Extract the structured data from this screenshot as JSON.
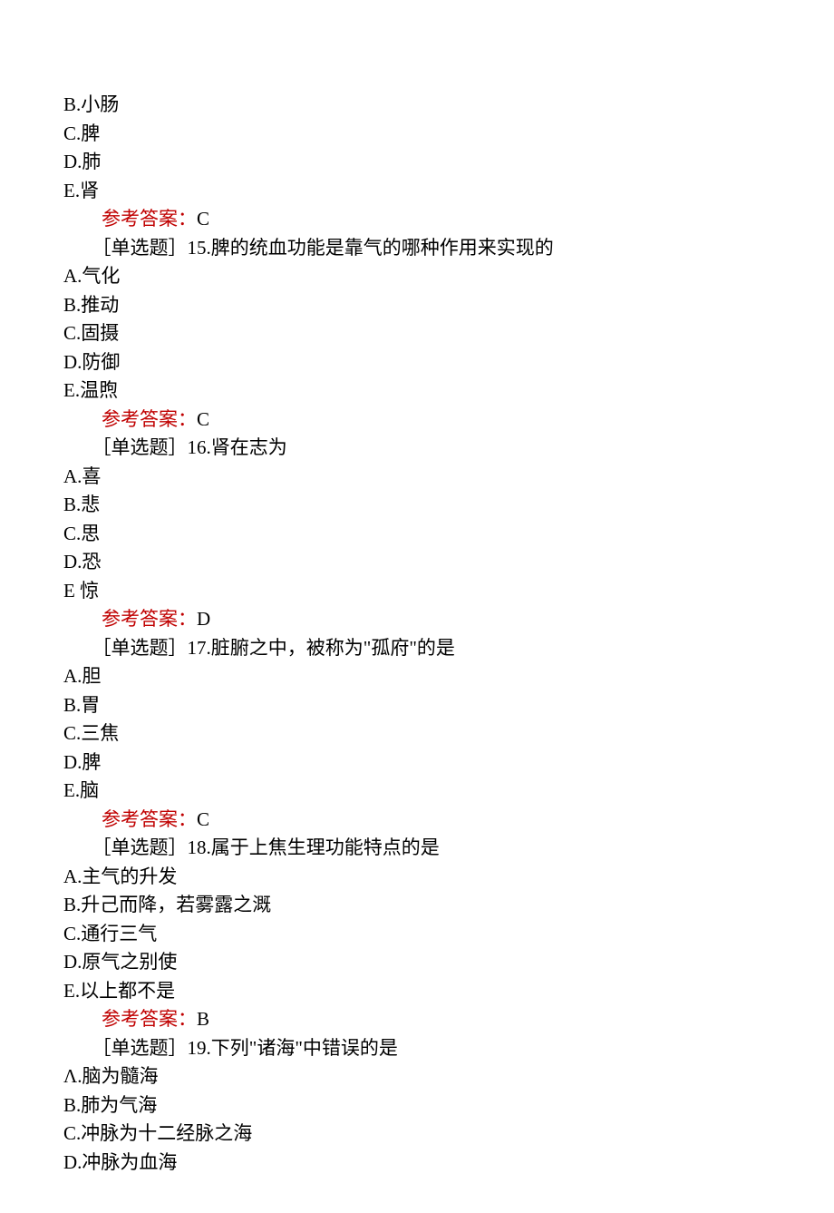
{
  "questions": [
    {
      "partial_options": [
        {
          "label": "B",
          "text": "小肠"
        },
        {
          "label": "C",
          "text": "脾"
        },
        {
          "label": "D",
          "text": "肺"
        },
        {
          "label": "E",
          "text": "肾"
        }
      ],
      "answer_label": "参考答案：",
      "answer": "C"
    },
    {
      "stem_prefix": "［单选题］",
      "number": "15",
      "stem": "脾的统血功能是靠气的哪种作用来实现的",
      "options": [
        {
          "label": "A",
          "text": "气化"
        },
        {
          "label": "B",
          "text": "推动"
        },
        {
          "label": "C",
          "text": "固摄"
        },
        {
          "label": "D",
          "text": "防御"
        },
        {
          "label": "E",
          "text": "温煦"
        }
      ],
      "answer_label": "参考答案：",
      "answer": "C"
    },
    {
      "stem_prefix": "［单选题］",
      "number": "16",
      "stem": "肾在志为",
      "options": [
        {
          "label": "A",
          "text": "喜"
        },
        {
          "label": "B",
          "text": "悲"
        },
        {
          "label": "C",
          "text": "思"
        },
        {
          "label": "D",
          "text": "恐"
        },
        {
          "label": "E",
          "text": "惊",
          "no_dot": true
        }
      ],
      "answer_label": "参考答案：",
      "answer": "D"
    },
    {
      "stem_prefix": "［单选题］",
      "number": "17",
      "stem": "脏腑之中，被称为\"孤府\"的是",
      "options": [
        {
          "label": "A",
          "text": "胆"
        },
        {
          "label": "B",
          "text": "胃"
        },
        {
          "label": "C",
          "text": "三焦"
        },
        {
          "label": "D",
          "text": "脾"
        },
        {
          "label": "E",
          "text": "脑"
        }
      ],
      "answer_label": "参考答案：",
      "answer": "C"
    },
    {
      "stem_prefix": "［单选题］",
      "number": "18",
      "stem": "属于上焦生理功能特点的是",
      "options": [
        {
          "label": "A",
          "text": "主气的升发"
        },
        {
          "label": "B",
          "text": "升己而降，若雾露之溉"
        },
        {
          "label": "C",
          "text": "通行三气"
        },
        {
          "label": "D",
          "text": "原气之别使"
        },
        {
          "label": "E",
          "text": "以上都不是"
        }
      ],
      "answer_label": "参考答案：",
      "answer": "B"
    },
    {
      "stem_prefix": "［单选题］",
      "number": "19",
      "stem": "下列\"诸海\"中错误的是",
      "options": [
        {
          "label": "Λ",
          "text": "脑为髓海"
        },
        {
          "label": "B",
          "text": "肺为气海"
        },
        {
          "label": "C",
          "text": "冲脉为十二经脉之海"
        },
        {
          "label": "D",
          "text": "冲脉为血海"
        }
      ]
    }
  ]
}
